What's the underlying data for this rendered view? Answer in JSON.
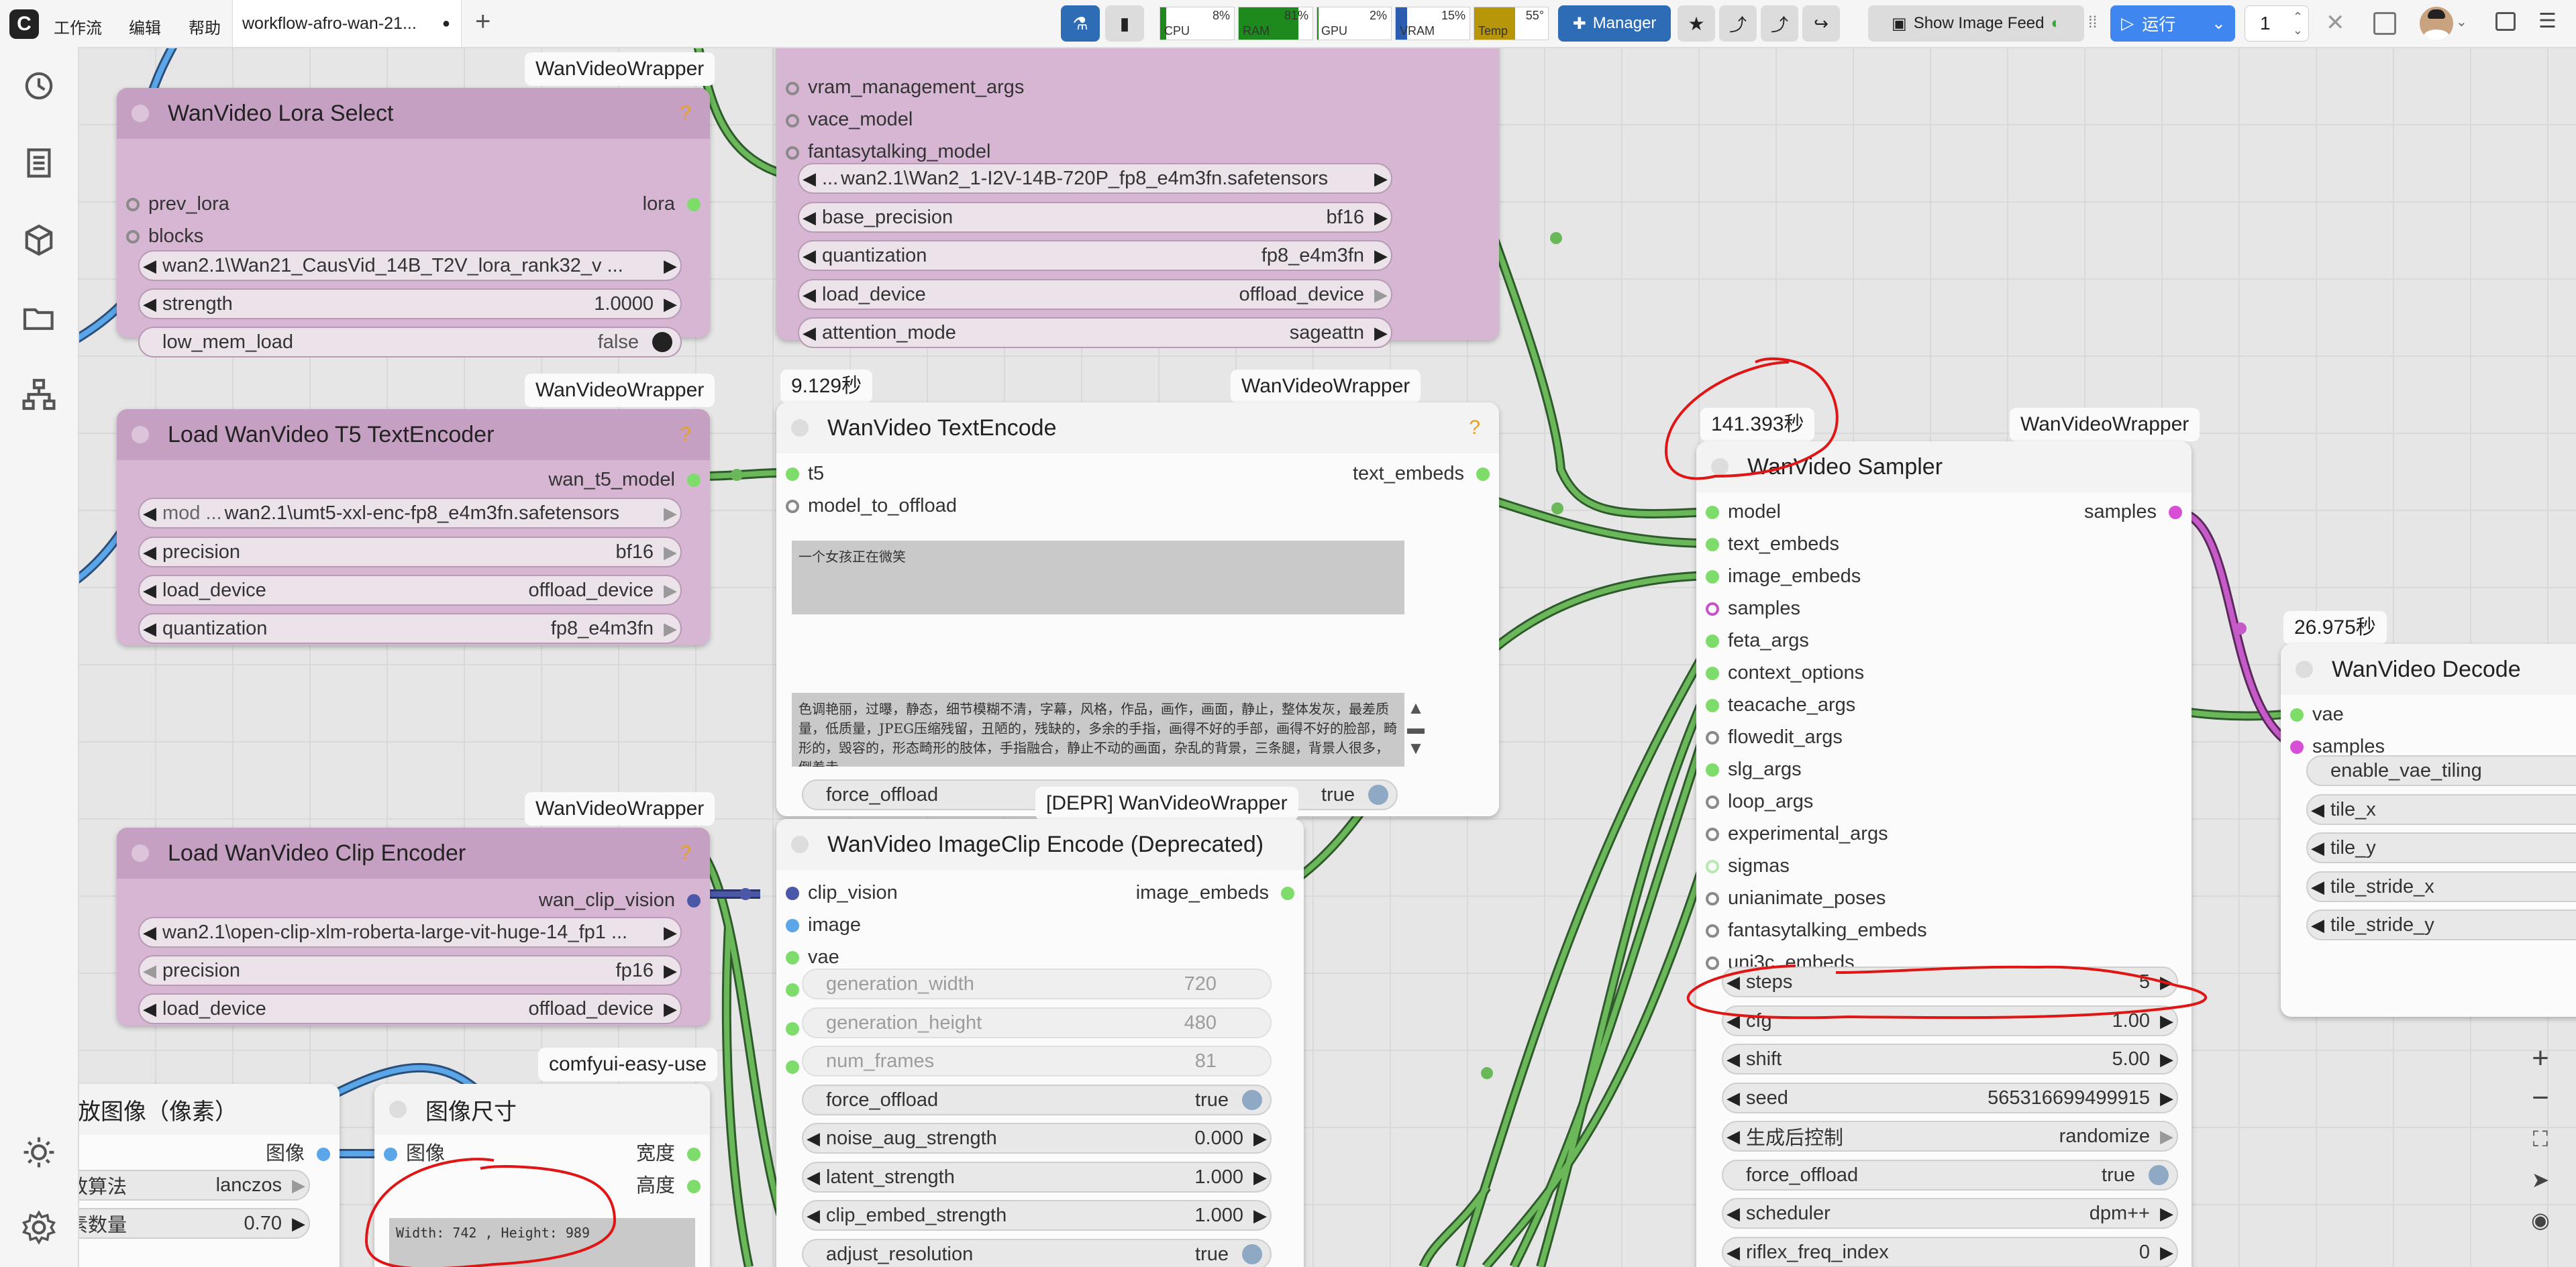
{
  "topbar": {
    "menu": [
      "工作流",
      "编辑",
      "帮助"
    ],
    "tab_title": "workflow-afro-wan-21...",
    "tab_dirty": "●",
    "add_tab": "+",
    "meters": [
      {
        "label": "CPU",
        "value": "8%",
        "fill_pct": 8,
        "color": "#1e8a1e"
      },
      {
        "label": "RAM",
        "value": "81%",
        "fill_pct": 81,
        "color": "#1e8a1e"
      },
      {
        "label": "GPU",
        "value": "2%",
        "fill_pct": 2,
        "color": "#1e8a1e"
      },
      {
        "label": "VRAM",
        "value": "15%",
        "fill_pct": 15,
        "color": "#2a5db0"
      },
      {
        "label": "Temp",
        "value": "55°",
        "fill_pct": 55,
        "color": "#b8960a"
      }
    ],
    "manager_label": "Manager",
    "show_image_feed": "Show Image Feed",
    "run_label": "运行",
    "queue_count": "1"
  },
  "groups": {
    "wrapper": "WanVideoWrapper",
    "deprecated": "[DEPR] WanVideoWrapper",
    "easy": "comfyui-easy-use"
  },
  "lora": {
    "title": "WanVideo Lora Select",
    "inputs": [
      "prev_lora",
      "blocks"
    ],
    "output": "lora",
    "widgets": [
      {
        "label": "",
        "value": "wan2.1\\Wan21_CausVid_14B_T2V_lora_rank32_v ..."
      },
      {
        "label": "strength",
        "value": "1.0000"
      },
      {
        "label": "low_mem_load",
        "value": "false"
      }
    ]
  },
  "t5": {
    "title": "Load WanVideo T5 TextEncoder",
    "output": "wan_t5_model",
    "widgets": [
      {
        "label": "mod ...",
        "value": "wan2.1\\umt5-xxl-enc-fp8_e4m3fn.safetensors"
      },
      {
        "label": "precision",
        "value": "bf16"
      },
      {
        "label": "load_device",
        "value": "offload_device"
      },
      {
        "label": "quantization",
        "value": "fp8_e4m3fn"
      }
    ]
  },
  "clip": {
    "title": "Load WanVideo Clip Encoder",
    "output": "wan_clip_vision",
    "widgets": [
      {
        "label": "",
        "value": "wan2.1\\open-clip-xlm-roberta-large-vit-huge-14_fp1 ..."
      },
      {
        "label": "precision",
        "value": "fp16"
      },
      {
        "label": "load_device",
        "value": "offload_device"
      }
    ]
  },
  "model": {
    "inputs": [
      "vram_management_args",
      "vace_model",
      "fantasytalking_model"
    ],
    "widgets": [
      {
        "label": "...",
        "value": "wan2.1\\Wan2_1-I2V-14B-720P_fp8_e4m3fn.safetensors"
      },
      {
        "label": "base_precision",
        "value": "bf16"
      },
      {
        "label": "quantization",
        "value": "fp8_e4m3fn"
      },
      {
        "label": "load_device",
        "value": "offload_device"
      },
      {
        "label": "attention_mode",
        "value": "sageattn"
      }
    ]
  },
  "textencode": {
    "time": "9.129秒",
    "title": "WanVideo TextEncode",
    "inputs": [
      "t5",
      "model_to_offload"
    ],
    "output": "text_embeds",
    "positive": "一个女孩正在微笑",
    "negative": "色调艳丽，过曝，静态，细节模糊不清，字幕，风格，作品，画作，画面，静止，整体发灰，最差质量，低质量，JPEG压缩残留，丑陋的，残缺的，多余的手指，画得不好的手部，画得不好的脸部，畸形的，毁容的，形态畸形的肢体，手指融合，静止不动的画面，杂乱的背景，三条腿，背景人很多，倒着走",
    "widgets": [
      {
        "label": "force_offload",
        "value": "true"
      }
    ]
  },
  "imageclip": {
    "title": "WanVideo ImageClip Encode (Deprecated)",
    "inputs": [
      "clip_vision",
      "image",
      "vae"
    ],
    "output": "image_embeds",
    "widgets": [
      {
        "label": "generation_width",
        "value": "720",
        "disabled": true
      },
      {
        "label": "generation_height",
        "value": "480",
        "disabled": true
      },
      {
        "label": "num_frames",
        "value": "81",
        "disabled": true
      },
      {
        "label": "force_offload",
        "value": "true"
      },
      {
        "label": "noise_aug_strength",
        "value": "0.000"
      },
      {
        "label": "latent_strength",
        "value": "1.000"
      },
      {
        "label": "clip_embed_strength",
        "value": "1.000"
      },
      {
        "label": "adjust_resolution",
        "value": "true"
      }
    ]
  },
  "scale": {
    "title": "放图像（像素）",
    "output": "图像",
    "widgets": [
      {
        "label": "放算法",
        "value": "lanczos"
      },
      {
        "label": "素数量",
        "value": "0.70"
      }
    ]
  },
  "imgsize": {
    "title": "图像尺寸",
    "input": "图像",
    "outputs": [
      "宽度",
      "高度"
    ],
    "text": "Width: 742 , Height: 989"
  },
  "sampler": {
    "time": "141.393秒",
    "title": "WanVideo Sampler",
    "output": "samples",
    "inputs": [
      "model",
      "text_embeds",
      "image_embeds",
      "samples",
      "feta_args",
      "context_options",
      "teacache_args",
      "flowedit_args",
      "slg_args",
      "loop_args",
      "experimental_args",
      "sigmas",
      "unianimate_poses",
      "fantasytalking_embeds",
      "uni3c_embeds"
    ],
    "widgets": [
      {
        "label": "steps",
        "value": "5"
      },
      {
        "label": "cfg",
        "value": "1.00"
      },
      {
        "label": "shift",
        "value": "5.00"
      },
      {
        "label": "seed",
        "value": "565316699499915"
      },
      {
        "label": "生成后控制",
        "value": "randomize"
      },
      {
        "label": "force_offload",
        "value": "true"
      },
      {
        "label": "scheduler",
        "value": "dpm++"
      },
      {
        "label": "riflex_freq_index",
        "value": "0"
      }
    ]
  },
  "decode": {
    "time": "26.975秒",
    "title": "WanVideo Decode",
    "inputs": [
      "vae",
      "samples"
    ],
    "widgets": [
      {
        "label": "enable_vae_tiling"
      },
      {
        "label": "tile_x"
      },
      {
        "label": "tile_y"
      },
      {
        "label": "tile_stride_x"
      },
      {
        "label": "tile_stride_y"
      }
    ]
  },
  "sidebar_icons": [
    "history-icon",
    "queue-icon",
    "model-library-icon",
    "workflows-icon",
    "node-library-icon",
    "theme-icon",
    "settings-icon"
  ],
  "canvas_tools": [
    "zoom-in-icon",
    "zoom-out-icon",
    "fit-view-icon",
    "pointer-mode-icon",
    "toggle-link-visibility-icon"
  ]
}
